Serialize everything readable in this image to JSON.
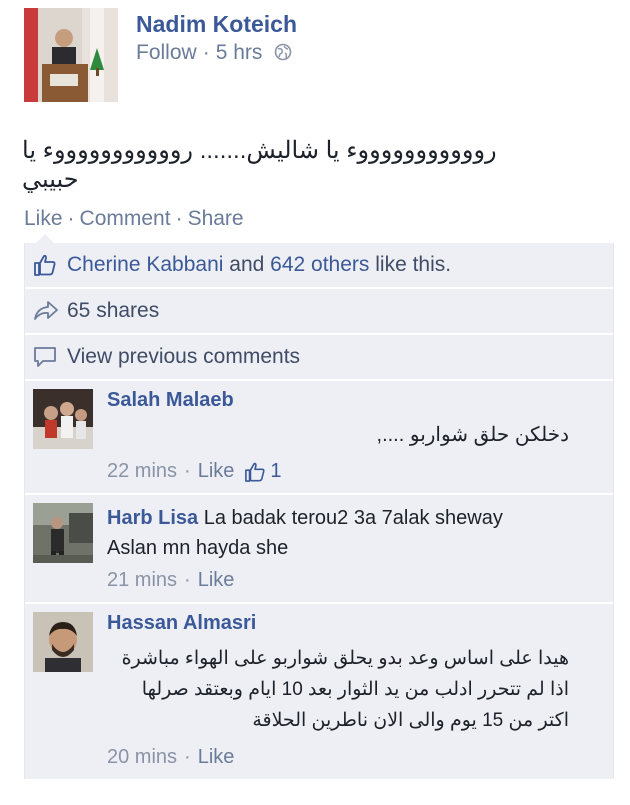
{
  "post": {
    "author": "Nadim Koteich",
    "follow_label": "Follow",
    "time": "5 hrs",
    "text": "روووووووووووء يا شاليش....... روووووووووووء يا حبيبي"
  },
  "actions": {
    "like": "Like",
    "comment": "Comment",
    "share": "Share"
  },
  "likes_summary": {
    "names": "Cherine Kabbani",
    "and": " and ",
    "others": "642 others",
    "suffix": " like this."
  },
  "shares": "65 shares",
  "view_previous": "View previous comments",
  "comments": [
    {
      "name": "Salah Malaeb",
      "text": "دخلكن حلق شواربو ....,",
      "time": "22 mins",
      "like": "Like",
      "like_count": "1"
    },
    {
      "name": "Harb Lisa",
      "text_inline": "La badak terou2 3a 7alak sheway",
      "text2": "Aslan mn hayda she",
      "time": "21 mins",
      "like": "Like"
    },
    {
      "name": "Hassan Almasri",
      "text": "هيدا على اساس وعد بدو يحلق شواربو على الهواء مباشرة اذا لم تتحرر ادلب من يد الثوار بعد 10 ايام وبعتقد صرلها اكتر من 15 يوم والى الان ناطرين الحلاقة",
      "time": "20 mins",
      "like": "Like"
    }
  ],
  "colors": {
    "link": "#3b5998",
    "meta": "#6b7b9a",
    "box": "#edeff4"
  },
  "icons": [
    "globe-icon",
    "thumbs-up-icon",
    "share-arrow-icon",
    "comment-bubble-icon"
  ]
}
